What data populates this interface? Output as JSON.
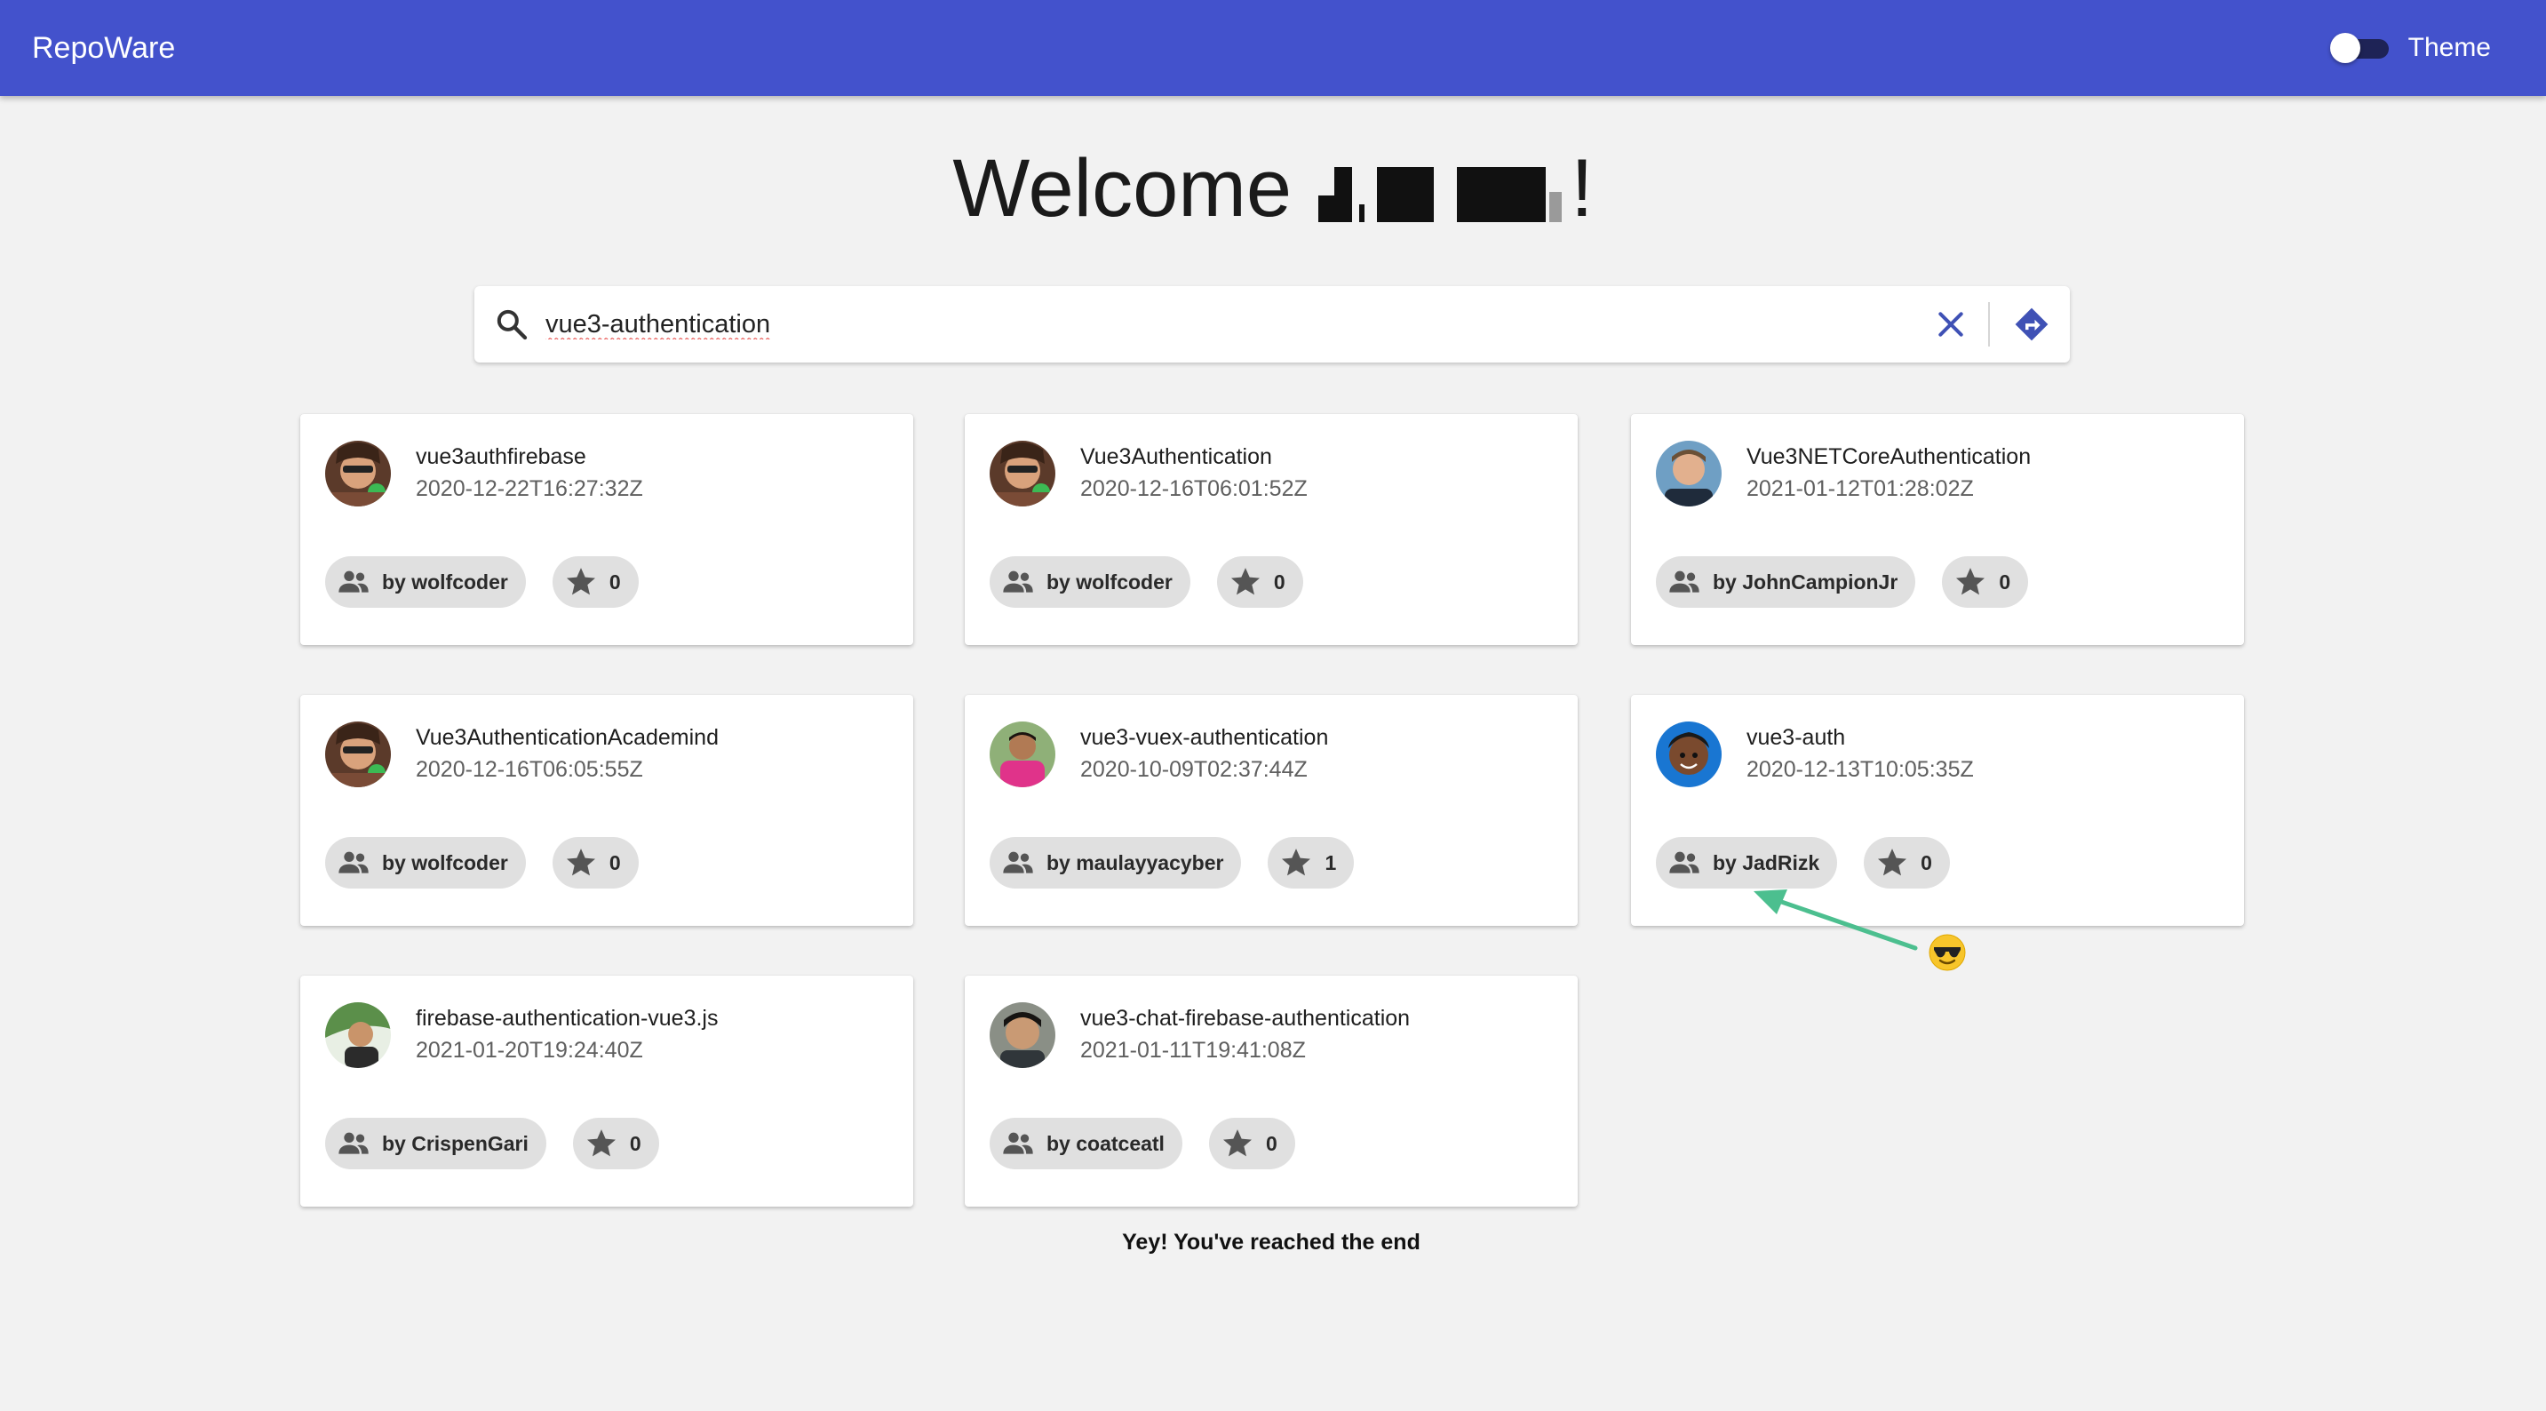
{
  "header": {
    "brand": "RepoWare",
    "theme_label": "Theme",
    "theme_toggle_on": false
  },
  "welcome": {
    "prefix": "Welcome",
    "suffix": "!"
  },
  "search": {
    "value": "vue3-authentication",
    "placeholder": ""
  },
  "repos": [
    {
      "name": "vue3authfirebase",
      "date": "2020-12-22T16:27:32Z",
      "owner": "by wolfcoder",
      "stars": "0",
      "avatar": "avatar-wolfcoder"
    },
    {
      "name": "Vue3Authentication",
      "date": "2020-12-16T06:01:52Z",
      "owner": "by wolfcoder",
      "stars": "0",
      "avatar": "avatar-wolfcoder"
    },
    {
      "name": "Vue3NETCoreAuthentication",
      "date": "2021-01-12T01:28:02Z",
      "owner": "by JohnCampionJr",
      "stars": "0",
      "avatar": "avatar-johncampionjr"
    },
    {
      "name": "Vue3AuthenticationAcademind",
      "date": "2020-12-16T06:05:55Z",
      "owner": "by wolfcoder",
      "stars": "0",
      "avatar": "avatar-wolfcoder"
    },
    {
      "name": "vue3-vuex-authentication",
      "date": "2020-10-09T02:37:44Z",
      "owner": "by maulayyacyber",
      "stars": "1",
      "avatar": "avatar-maulayyacyber"
    },
    {
      "name": "vue3-auth",
      "date": "2020-12-13T10:05:35Z",
      "owner": "by JadRizk",
      "stars": "0",
      "avatar": "avatar-jadrizk"
    },
    {
      "name": "firebase-authentication-vue3.js",
      "date": "2021-01-20T19:24:40Z",
      "owner": "by CrispenGari",
      "stars": "0",
      "avatar": "avatar-crispengari"
    },
    {
      "name": "vue3-chat-firebase-authentication",
      "date": "2021-01-11T19:41:08Z",
      "owner": "by coatceatl",
      "stars": "0",
      "avatar": "avatar-coatceatl"
    }
  ],
  "footer": {
    "end_text": "Yey! You've reached the end"
  },
  "colors": {
    "appbar": "#4352cc",
    "accent": "#3f51b5",
    "annotation_arrow": "#4cbf8f"
  },
  "icons": {
    "search": "search-icon",
    "clear": "close-icon",
    "go": "directions-icon",
    "owner": "people-icon",
    "star": "star-icon",
    "annotation": "sunglasses-emoji-icon"
  }
}
